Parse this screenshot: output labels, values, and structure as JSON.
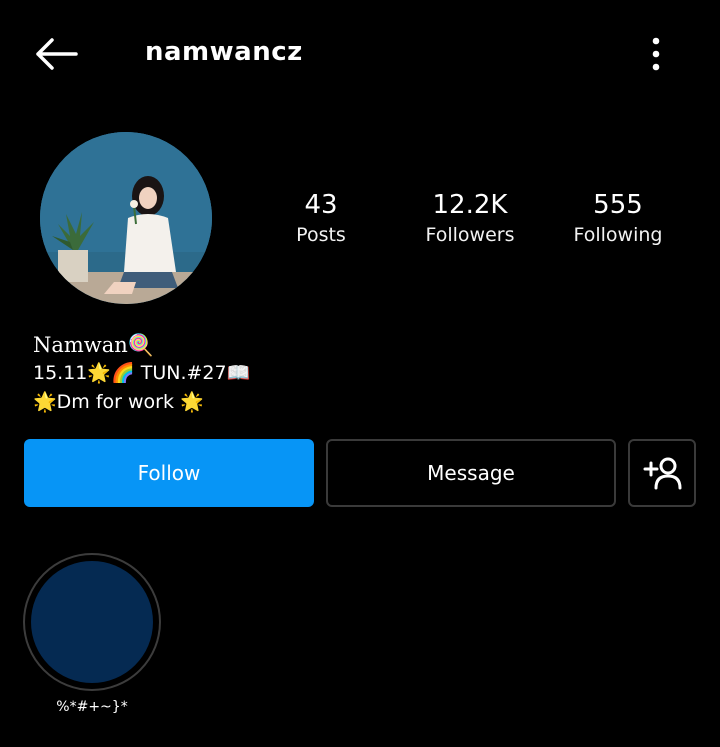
{
  "header": {
    "username": "namwancz",
    "back_icon": "arrow-left-icon",
    "menu_icon": "more-vertical-icon"
  },
  "profile": {
    "avatar_alt": "profile-photo",
    "stats": [
      {
        "value": "43",
        "label": "Posts"
      },
      {
        "value": "12.2K",
        "label": "Followers"
      },
      {
        "value": "555",
        "label": "Following"
      }
    ]
  },
  "bio": {
    "name": "Namwan🍭",
    "line1": "15.11🌟🌈 TUN.#27📖",
    "line2": "🌟Dm for work 🌟"
  },
  "actions": {
    "follow_label": "Follow",
    "message_label": "Message",
    "add_user_icon": "add-user-icon"
  },
  "highlights": [
    {
      "label": "%*#+~}*"
    }
  ],
  "colors": {
    "background": "#000000",
    "follow_button": "#0795f6",
    "button_border": "#3a3a3a",
    "highlight_fill": "#052a52"
  }
}
